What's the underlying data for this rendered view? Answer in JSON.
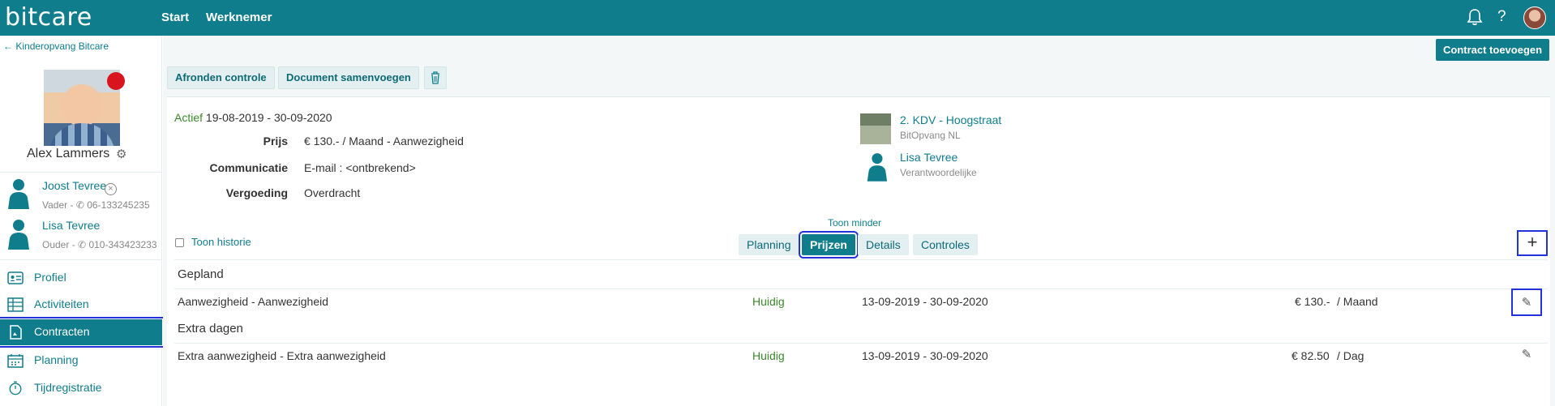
{
  "app": {
    "logo": "bitcare",
    "nav": [
      "Start",
      "Werknemer"
    ],
    "icons": [
      "bell-icon",
      "help-icon",
      "user-avatar"
    ],
    "accent_color": "#0f7d8c"
  },
  "sidebar": {
    "back_label": "Kinderopvang Bitcare",
    "child_name": "Alex Lammers",
    "parents": [
      {
        "name": "Joost Tevree",
        "role": "Vader",
        "phone": "06-133245235"
      },
      {
        "name": "Lisa Tevree",
        "role": "Ouder",
        "phone": "010-343423233"
      }
    ],
    "menu": [
      {
        "label": "Profiel",
        "icon": "id-card-icon"
      },
      {
        "label": "Activiteiten",
        "icon": "table-icon"
      },
      {
        "label": "Contracten",
        "icon": "document-icon",
        "active": true
      },
      {
        "label": "Planning",
        "icon": "calendar-icon"
      },
      {
        "label": "Tijdregistratie",
        "icon": "stopwatch-icon"
      }
    ]
  },
  "toolbar": {
    "contract_add": "Contract toevoegen",
    "finish_check": "Afronden controle",
    "merge_docs": "Document samenvoegen"
  },
  "contract": {
    "status": "Actief",
    "period": "19-08-2019 - 30-09-2020",
    "fields": [
      {
        "label": "Prijs",
        "value": "€ 130.- / Maand - Aanwezigheid"
      },
      {
        "label": "Communicatie",
        "value": "E-mail : <ontbrekend>"
      },
      {
        "label": "Vergoeding",
        "value": "Overdracht"
      }
    ],
    "location_name": "2. KDV - Hoogstraat",
    "location_org": "BitOpvang NL",
    "responsible_name": "Lisa Tevree",
    "responsible_role": "Verantwoordelijke"
  },
  "tabs": {
    "show_less": "Toon minder",
    "history": "Toon historie",
    "items": [
      "Planning",
      "Prijzen",
      "Details",
      "Controles"
    ],
    "active": "Prijzen"
  },
  "prices": {
    "sections": [
      {
        "title": "Gepland",
        "rows": [
          {
            "name": "Aanwezigheid - Aanwezigheid",
            "status": "Huidig",
            "period": "13-09-2019 - 30-09-2020",
            "amount": "€ 130.-",
            "unit": "/ Maand"
          }
        ]
      },
      {
        "title": "Extra dagen",
        "rows": [
          {
            "name": "Extra aanwezigheid - Extra aanwezigheid",
            "status": "Huidig",
            "period": "13-09-2019 - 30-09-2020",
            "amount": "€ 82.50",
            "unit": "/ Dag"
          }
        ]
      }
    ]
  }
}
